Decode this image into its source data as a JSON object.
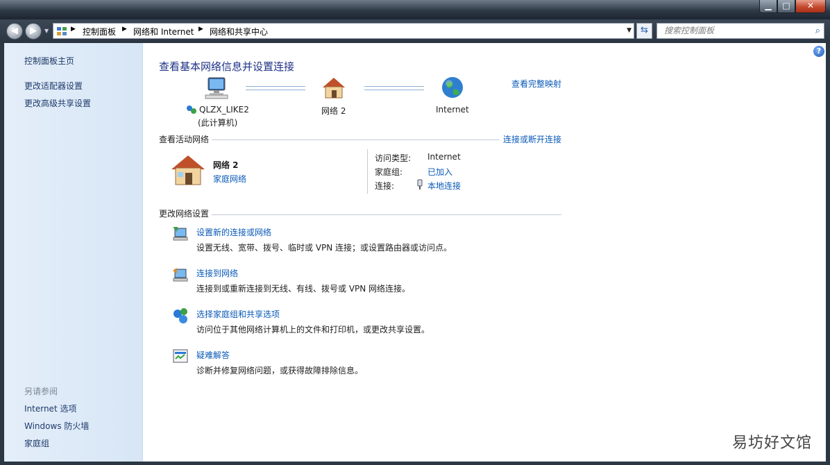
{
  "window": {
    "min_label": "▁",
    "max_label": "□",
    "close_label": "✕"
  },
  "addressbar": {
    "crumbs": [
      "控制面板",
      "网络和 Internet",
      "网络和共享中心"
    ]
  },
  "search": {
    "placeholder": "搜索控制面板"
  },
  "sidebar": {
    "home": "控制面板主页",
    "links": [
      "更改适配器设置",
      "更改高级共享设置"
    ],
    "see_also_heading": "另请参阅",
    "see_also": [
      "Internet 选项",
      "Windows 防火墙",
      "家庭组"
    ]
  },
  "main": {
    "title": "查看基本网络信息并设置连接",
    "full_map": "查看完整映射",
    "map": {
      "computer_name": "QLZX_LIKE2",
      "computer_sub": "(此计算机)",
      "network_name": "网络  2",
      "internet": "Internet"
    },
    "active": {
      "heading": "查看活动网络",
      "connect_link": "连接或断开连接",
      "network_name": "网络  2",
      "network_type": "家庭网络",
      "access_type_label": "访问类型:",
      "access_type_value": "Internet",
      "homegroup_label": "家庭组:",
      "homegroup_value": "已加入",
      "connection_label": "连接:",
      "connection_value": "本地连接"
    },
    "change": {
      "heading": "更改网络设置",
      "items": [
        {
          "title": "设置新的连接或网络",
          "desc": "设置无线、宽带、拨号、临时或 VPN 连接；或设置路由器或访问点。"
        },
        {
          "title": "连接到网络",
          "desc": "连接到或重新连接到无线、有线、拨号或 VPN 网络连接。"
        },
        {
          "title": "选择家庭组和共享选项",
          "desc": "访问位于其他网络计算机上的文件和打印机，或更改共享设置。"
        },
        {
          "title": "疑难解答",
          "desc": "诊断并修复网络问题，或获得故障排除信息。"
        }
      ]
    }
  },
  "watermark": "易坊好文馆"
}
